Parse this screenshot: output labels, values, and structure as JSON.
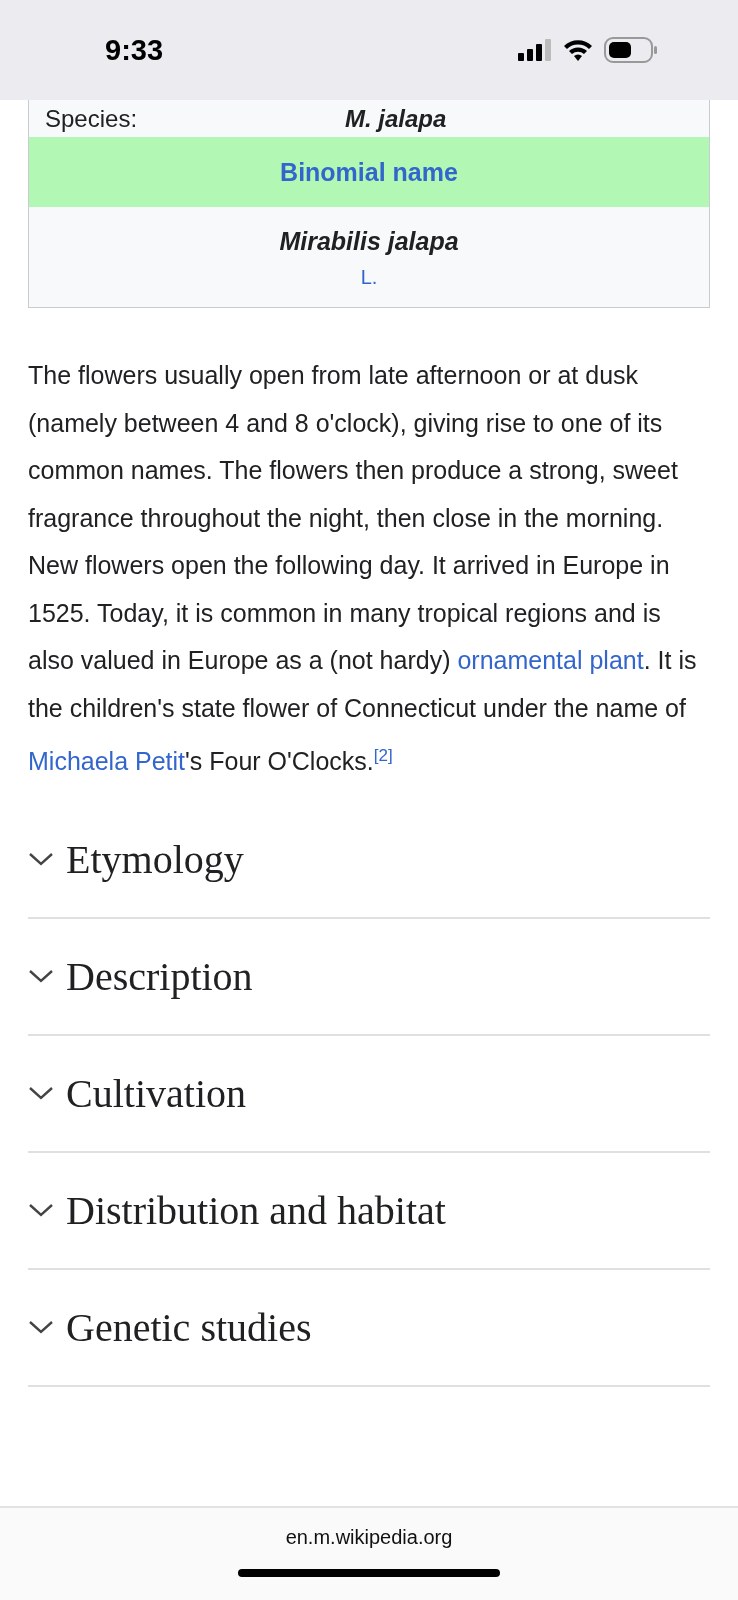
{
  "status_bar": {
    "time": "9:33"
  },
  "infobox": {
    "rows": [
      {
        "kind": "field",
        "label": "Species:",
        "value": "M. jalapa"
      },
      {
        "kind": "header",
        "text": "Binomial name"
      },
      {
        "kind": "binomial",
        "name": "Mirabilis jalapa",
        "authority": "L."
      }
    ]
  },
  "paragraph": [
    {
      "kind": "text",
      "text": "The flowers usually open from late afternoon or at dusk (namely between 4 and 8 o'clock), giving rise to one of its common names. The flowers then produce a strong, sweet fragrance throughout the night, then close in the morning. New flowers open the following day. It arrived in Europe in 1525. Today, it is common in many tropical regions and is also valued in Europe as a (not hardy) "
    },
    {
      "kind": "link",
      "text": "ornamental plant"
    },
    {
      "kind": "text",
      "text": ". It is the children's state flower of Connecticut under the name of "
    },
    {
      "kind": "link",
      "text": "Michaela Petit"
    },
    {
      "kind": "text",
      "text": "'s Four O'Clocks."
    },
    {
      "kind": "ref",
      "text": "[2]"
    }
  ],
  "sections": [
    {
      "title": "Etymology",
      "expanded": false
    },
    {
      "title": "Description",
      "expanded": false
    },
    {
      "title": "Cultivation",
      "expanded": false
    },
    {
      "title": "Distribution and habitat",
      "expanded": false
    },
    {
      "title": "Genetic studies",
      "expanded": false
    }
  ],
  "address_bar": {
    "url": "en.m.wikipedia.org"
  }
}
